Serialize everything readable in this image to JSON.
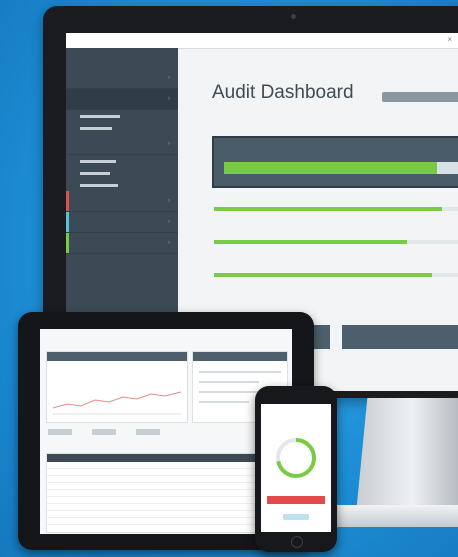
{
  "desktop": {
    "topbar": {
      "app_name": "",
      "close_glyph": "×"
    },
    "sidebar": {
      "brand_small": "",
      "brand_big": "",
      "items": [
        {
          "label": "",
          "chevron": "›"
        },
        {
          "label": "",
          "chevron": "›"
        },
        {
          "label": "",
          "chevron": "›"
        },
        {
          "label": "",
          "chevron": "›"
        },
        {
          "label": "",
          "chevron": "›"
        },
        {
          "label": "",
          "chevron": "›"
        }
      ],
      "accent_colors": [
        "#d9534f",
        "#5bc0de",
        "#7acb44"
      ]
    },
    "main": {
      "breadcrumb": "",
      "title": "Audit Dashboard",
      "section_label": "",
      "big_card": {
        "title": "",
        "progress": 0.85
      },
      "metrics": [
        {
          "label": "",
          "sub": "",
          "progress": 0.92
        },
        {
          "label": "",
          "sub": "",
          "progress": 0.78
        },
        {
          "label": "",
          "sub": "",
          "progress": 0.88
        }
      ]
    }
  },
  "tablet": {
    "header": ""
  },
  "phone": {
    "title": "",
    "gauge_progress": 0.72
  },
  "colors": {
    "accent_green": "#7acb44",
    "accent_red": "#e34a4a",
    "sidebar_bg": "#3b4a55",
    "background_blue": "#1e8fd6"
  }
}
